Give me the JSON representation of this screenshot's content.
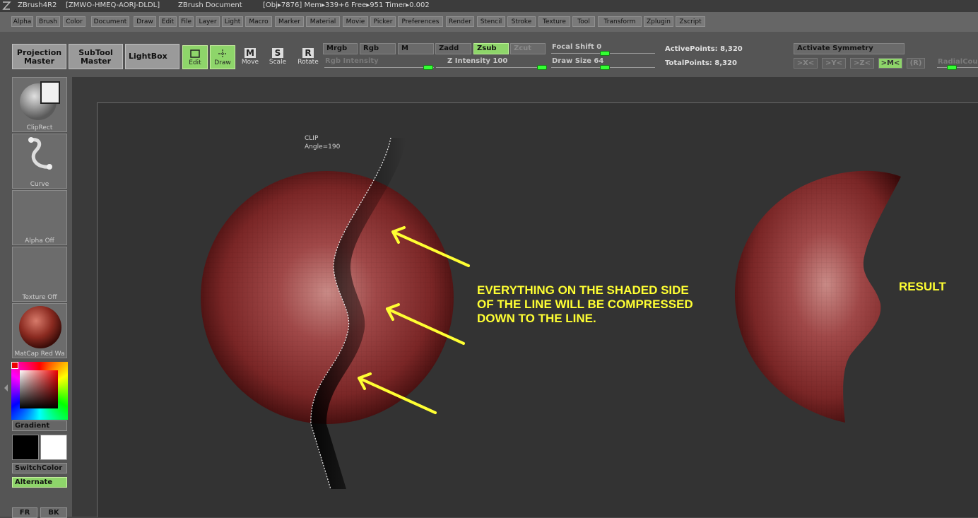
{
  "titlebar": {
    "app": "ZBrush4R2",
    "build": "[ZMWO-HMEQ-AORJ-DLDL]",
    "doc": "ZBrush Document",
    "stats": "[Obj▸7876] Mem▸339+6  Free▸951  Timer▸0.002"
  },
  "menu": [
    "Alpha",
    "Brush",
    "Color",
    "Document",
    "Draw",
    "Edit",
    "File",
    "Layer",
    "Light",
    "Macro",
    "Marker",
    "Material",
    "Movie",
    "Picker",
    "Preferences",
    "Render",
    "Stencil",
    "Stroke",
    "Texture",
    "Tool",
    "Transform",
    "Zplugin",
    "Zscript"
  ],
  "shelf": {
    "projection_master": "Projection\nMaster",
    "subtool_master": "SubTool\nMaster",
    "lightbox": "LightBox",
    "edit": "Edit",
    "draw": "Draw",
    "move": "Move",
    "scale": "Scale",
    "rotate": "Rotate",
    "mrgb": "Mrgb",
    "rgb": "Rgb",
    "m": "M",
    "zadd": "Zadd",
    "zsub": "Zsub",
    "zcut": "Zcut",
    "rgb_intensity": "Rgb Intensity",
    "z_intensity": "Z Intensity 100",
    "focal_shift": "Focal Shift 0",
    "draw_size": "Draw Size 64",
    "active_points": "ActivePoints: 8,320",
    "total_points": "TotalPoints: 8,320",
    "activate_symmetry": "Activate Symmetry",
    "sym_x": ">X<",
    "sym_y": ">Y<",
    "sym_z": ">Z<",
    "sym_m": ">M<",
    "sym_r": "(R)",
    "radial_count": "RadialCou"
  },
  "lefttray": {
    "cliprect": "ClipRect",
    "curve": "Curve",
    "alpha": "Alpha  Off",
    "texture": "Texture  Off",
    "matcap": "MatCap  Red  Wa",
    "gradient": "Gradient",
    "switchcolor": "SwitchColor",
    "alternate": "Alternate",
    "fr": "FR",
    "bk": "BK"
  },
  "canvas": {
    "clip_label": "CLIP",
    "clip_angle": "Angle=190",
    "annotation": "EVERYTHING ON THE SHADED SIDE\nOF THE LINE WILL BE COMPRESSED\nDOWN TO THE LINE.",
    "result": "RESULT"
  },
  "colors": {
    "accent_green": "#8ed56a",
    "annotation_yellow": "#ffff33",
    "sphere_red": "#8a2a2a"
  }
}
